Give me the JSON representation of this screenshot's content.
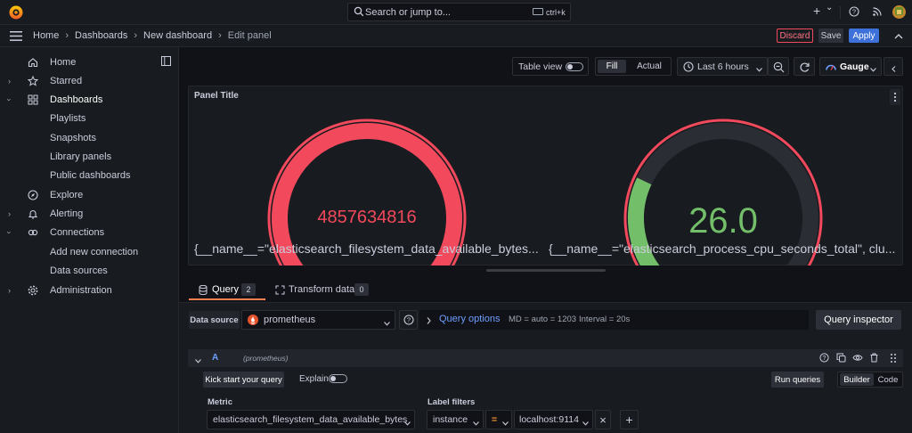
{
  "topbar": {
    "search_placeholder": "Search or jump to...",
    "search_shortcut": "ctrl+k",
    "new_icon": "+",
    "chevron": "⌄"
  },
  "breadcrumb": {
    "items": [
      "Home",
      "Dashboards",
      "New dashboard",
      "Edit panel"
    ],
    "separator": "›"
  },
  "actions": {
    "discard": "Discard",
    "save": "Save",
    "apply": "Apply"
  },
  "sidebar": {
    "items": [
      {
        "label": "Home",
        "icon": "home-icon"
      },
      {
        "label": "Starred",
        "icon": "star-icon"
      },
      {
        "label": "Dashboards",
        "icon": "apps-icon"
      },
      {
        "label": "Playlists"
      },
      {
        "label": "Snapshots"
      },
      {
        "label": "Library panels"
      },
      {
        "label": "Public dashboards"
      },
      {
        "label": "Explore",
        "icon": "compass-icon"
      },
      {
        "label": "Alerting",
        "icon": "bell-icon"
      },
      {
        "label": "Connections",
        "icon": "link-icon"
      },
      {
        "label": "Add new connection"
      },
      {
        "label": "Data sources"
      },
      {
        "label": "Administration",
        "icon": "cog-icon"
      }
    ]
  },
  "toolbar": {
    "table_view": "Table view",
    "fill": "Fill",
    "actual": "Actual",
    "time_range": "Last 6 hours",
    "visualization": "Gauge"
  },
  "panel": {
    "title": "Panel Title",
    "gauges": [
      {
        "value": "4857634816",
        "fraction": 1.0,
        "value_color": "#f2495c",
        "arc_color": "#f2495c",
        "label": "{__name__=\"elasticsearch_filesystem_data_available_bytes..."
      },
      {
        "value": "26.0",
        "fraction": 0.26,
        "value_color": "#73bf69",
        "arc_color": "#73bf69",
        "label": "{__name__=\"elasticsearch_process_cpu_seconds_total\", clu..."
      }
    ]
  },
  "tabs": {
    "query": "Query",
    "query_count": "2",
    "transform": "Transform data",
    "transform_count": "0"
  },
  "datasource": {
    "label": "Data source",
    "name": "prometheus",
    "query_options": "Query options",
    "md": "MD = auto = 1203",
    "interval": "Interval = 20s",
    "inspector": "Query inspector"
  },
  "query_row": {
    "ref": "A",
    "source": "(prometheus)"
  },
  "builder": {
    "kick_start": "Kick start your query",
    "explain": "Explain",
    "run_queries": "Run queries",
    "builder": "Builder",
    "code": "Code",
    "metric_label": "Metric",
    "metric_value": "elasticsearch_filesystem_data_available_bytes",
    "label_filters": "Label filters",
    "filter_label": "instance",
    "filter_op": "=",
    "filter_value": "localhost:9114",
    "remove": "×",
    "add": "+"
  },
  "colors": {
    "accent_blue": "#3d71d9",
    "red": "#f2495c",
    "green": "#73bf69",
    "query_blue": "#6e9fff"
  }
}
